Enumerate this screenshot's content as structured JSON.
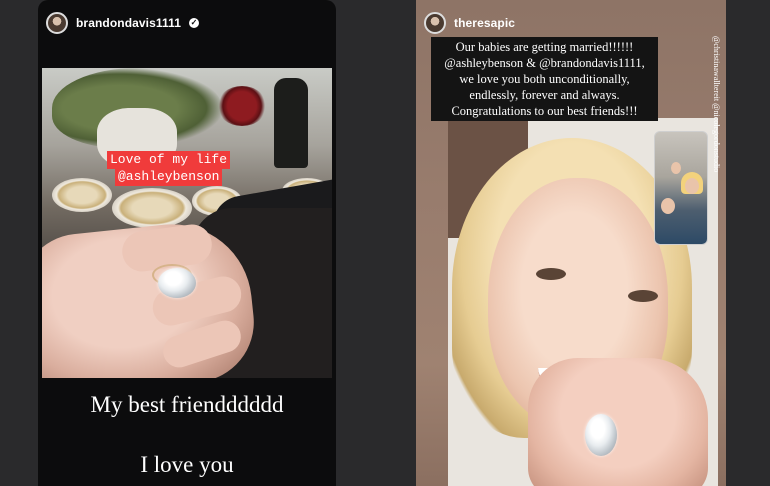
{
  "left_story": {
    "username": "brandondavis1111",
    "sticker_line1": "Love of my life",
    "sticker_line2": "@ashleybenson",
    "caption1": "My best friendddddd",
    "caption2": "I love you"
  },
  "right_story": {
    "username": "theresapic",
    "text_lines": [
      "Our babies are getting married!!!!!!",
      "@ashleybenson  & @brandondavis1111,",
      "we love you both unconditionally,",
      "endlessly, forever and always.",
      "Congratulations to our best friends!!!"
    ],
    "credit": "@christinawalltereit @nicolegordonstudio"
  },
  "colors": {
    "sticker_bg": "#f03b3b",
    "left_story_bg": "#0c0c0d",
    "text_box_bg": "#141414"
  }
}
